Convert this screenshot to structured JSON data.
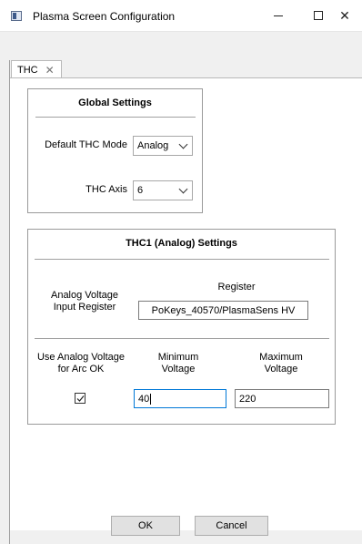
{
  "window": {
    "title": "Plasma Screen Configuration"
  },
  "tabs": [
    {
      "label": "THC",
      "close_glyph": "✕"
    }
  ],
  "global_settings": {
    "title": "Global Settings",
    "thc_mode_label": "Default THC Mode",
    "thc_mode_value": "Analog",
    "thc_axis_label": "THC Axis",
    "thc_axis_value": "6"
  },
  "thc1": {
    "title": "THC1 (Analog) Settings",
    "register_header": "Register",
    "analog_input_label_line1": "Analog Voltage",
    "analog_input_label_line2": "Input Register",
    "register_value": "PoKeys_40570/PlasmaSens HV",
    "arc_ok_label_line1": "Use Analog Voltage",
    "arc_ok_label_line2": "for Arc OK",
    "min_label_line1": "Minimum",
    "min_label_line2": "Voltage",
    "max_label_line1": "Maximum",
    "max_label_line2": "Voltage",
    "arc_ok_checked": true,
    "min_voltage": "40",
    "max_voltage": "220"
  },
  "footer": {
    "ok_label": "OK",
    "cancel_label": "Cancel"
  }
}
